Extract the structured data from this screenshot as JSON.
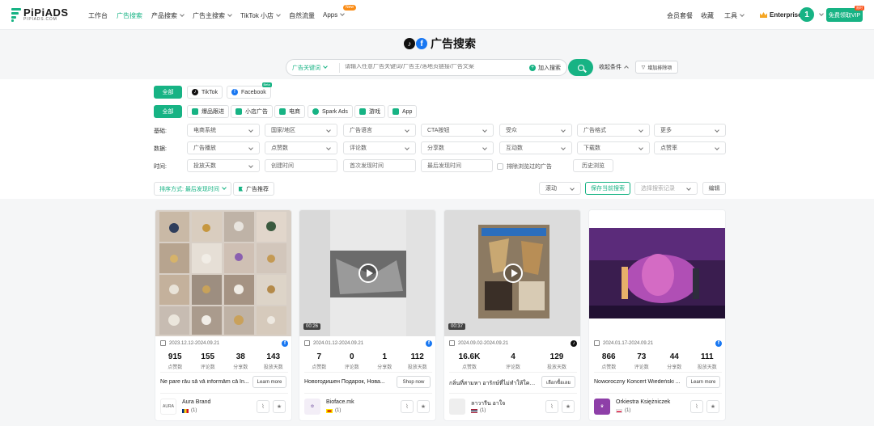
{
  "brand": {
    "name": "PiPiADS",
    "domain": "PIPIADS.COM"
  },
  "nav": {
    "items": [
      "工作台",
      "广告搜索",
      "产品搜索",
      "广告主搜索",
      "TikTok 小店",
      "自然流量",
      "Apps"
    ],
    "apps_badge": "New",
    "right": {
      "membership": "会员套餐",
      "favorites": "收藏",
      "tools": "工具",
      "plan": "Enterprise",
      "avatar_initial": "1",
      "vip_button": "免费领取VIP",
      "vip_tag": "限时"
    }
  },
  "hero": {
    "title": "广告搜索"
  },
  "search": {
    "type_label": "广告关键词",
    "placeholder": "请输入任意广告关键词/广告主/落地页链接/广告文案",
    "add_label": "加入搜索",
    "collapse_label": "收起条件",
    "save_filter_label": "增加排除项"
  },
  "platform_tabs": [
    {
      "label": "全部",
      "active": true,
      "icon": ""
    },
    {
      "label": "TikTok",
      "active": false,
      "icon": "tiktok-icon"
    },
    {
      "label": "Facebook",
      "active": false,
      "icon": "facebook-icon",
      "badge": "Beta"
    }
  ],
  "type_tabs": [
    {
      "label": "全部",
      "active": true,
      "icon": ""
    },
    {
      "label": "爆品跟进",
      "icon": "hot-icon",
      "color": "#17b384"
    },
    {
      "label": "小店广告",
      "icon": "shop-icon",
      "color": "#17b384"
    },
    {
      "label": "电商",
      "icon": "cart-icon",
      "color": "#17b384"
    },
    {
      "label": "Spark Ads",
      "icon": "spark-icon",
      "color": "#17b384"
    },
    {
      "label": "游戏",
      "icon": "game-icon",
      "color": "#17b384"
    },
    {
      "label": "App",
      "icon": "app-icon",
      "color": "#17b384"
    }
  ],
  "filters": {
    "row1_label": "基础:",
    "row1": [
      "电商系统",
      "国家/地区",
      "广告语言",
      "CTA按钮",
      "受众",
      "广告格式",
      "更多"
    ],
    "row2_label": "数据:",
    "row2": [
      "广告播放",
      "点赞数",
      "评论数",
      "分享数",
      "互动数",
      "下载数",
      "点赞率"
    ],
    "row3_label": "时间:",
    "row3": [
      "投放天数",
      "创建时间",
      "首次发现时间",
      "最后发现时间"
    ],
    "exclude_label": "排除浏览过的广告",
    "history_label": "历史浏览"
  },
  "toolbar": {
    "sort_label": "排序方式: 最后发现时间",
    "recommend_label": "广告推荐",
    "scroll_label": "滚动",
    "save_search_label": "保存当前搜索",
    "select_record_placeholder": "选择搜索记录",
    "edit_label": "编辑"
  },
  "cards": [
    {
      "date": "2023.12.12-2024.09.21",
      "platform": "facebook-icon",
      "stats": [
        {
          "v": "915",
          "l": "点赞数"
        },
        {
          "v": "155",
          "l": "评论数"
        },
        {
          "v": "38",
          "l": "分享数"
        },
        {
          "v": "143",
          "l": "投放天数"
        }
      ],
      "desc": "Ne pare rău să vă informăm că în...",
      "btn": "Learn more",
      "advertiser": "Aura Brand",
      "adv_logo_text": "AURA",
      "country": "(1)",
      "duration": ""
    },
    {
      "date": "2024.01.12-2024.09.21",
      "platform": "facebook-icon",
      "stats": [
        {
          "v": "7",
          "l": "点赞数"
        },
        {
          "v": "0",
          "l": "评论数"
        },
        {
          "v": "1",
          "l": "分享数"
        },
        {
          "v": "112",
          "l": "投放天数"
        }
      ],
      "desc": "Новогодишен Подарок, Нова...",
      "btn": "Shop now",
      "advertiser": "Bioface.mk",
      "adv_logo_text": "",
      "country": "(1)",
      "duration": "00:26"
    },
    {
      "date": "2024.09.02-2024.09.21",
      "platform": "tiktok-icon",
      "stats": [
        {
          "v": "16.6K",
          "l": "点赞数"
        },
        {
          "v": "4",
          "l": "评论数"
        },
        {
          "v": "",
          "l": "投放天数"
        },
        {
          "v": "129",
          "l": "投放天数"
        }
      ],
      "desc": "กลิ่นที่สามหา อารักษ์ที่ไม่ทำให้ใคร 😍...",
      "btn": "เลือกซื้อเลย",
      "advertiser": "ลาวารีน อาใจ",
      "adv_logo_text": "",
      "country": "(1)",
      "duration": "00:37"
    },
    {
      "date": "2024.01.17-2024.09.21",
      "platform": "facebook-icon",
      "stats": [
        {
          "v": "866",
          "l": "点赞数"
        },
        {
          "v": "73",
          "l": "评论数"
        },
        {
          "v": "44",
          "l": "分享数"
        },
        {
          "v": "111",
          "l": "投放天数"
        }
      ],
      "desc": "Noworoczny Koncert Wiedeński ...",
      "btn": "Learn more",
      "advertiser": "Orkiestra Księżniczek",
      "adv_logo_text": "",
      "country": "(1)",
      "duration": ""
    }
  ]
}
